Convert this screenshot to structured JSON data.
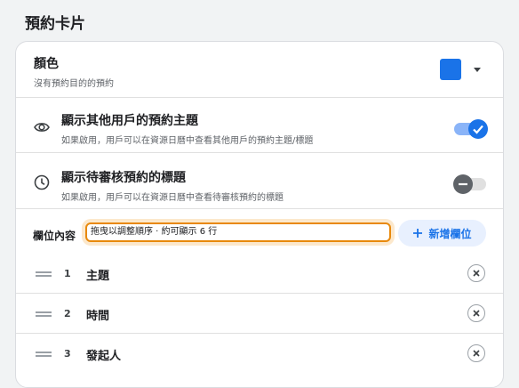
{
  "page": {
    "title": "預約卡片"
  },
  "color_row": {
    "title": "顏色",
    "subtitle": "沒有預約目的的預約",
    "swatch_color": "#1a73e8"
  },
  "settings": [
    {
      "icon": "eye-icon",
      "title": "顯示其他用戶的預約主題",
      "subtitle": "如果啟用，用戶可以在資源日曆中查看其他用戶的預約主題/標題",
      "enabled": true
    },
    {
      "icon": "clock-icon",
      "title": "顯示待審核預約的標題",
      "subtitle": "如果啟用，用戶可以在資源日曆中查看待審核預約的標題",
      "enabled": false
    }
  ],
  "fields": {
    "label": "欄位內容",
    "input_value": "拖曳以調整順序 · 約可顯示 6 行",
    "add_button": "新增欄位",
    "items": [
      {
        "num": "1",
        "name": "主題"
      },
      {
        "num": "2",
        "name": "時間"
      },
      {
        "num": "3",
        "name": "發起人"
      }
    ]
  }
}
